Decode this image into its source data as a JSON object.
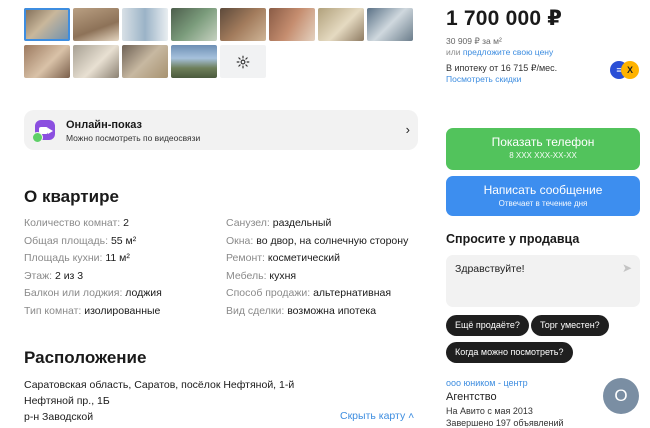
{
  "gallery": {
    "more_icon": "gear-icon"
  },
  "online_view": {
    "title": "Онлайн-показ",
    "subtitle": "Можно посмотреть по видеосвязи",
    "chevron": "›"
  },
  "about": {
    "heading": "О квартире",
    "left": [
      {
        "key": "Количество комнат: ",
        "value": "2"
      },
      {
        "key": "Общая площадь: ",
        "value": "55 м²"
      },
      {
        "key": "Площадь кухни: ",
        "value": "11 м²"
      },
      {
        "key": "Этаж: ",
        "value": "2 из 3"
      },
      {
        "key": "Балкон или лоджия: ",
        "value": "лоджия"
      },
      {
        "key": "Тип комнат: ",
        "value": "изолированные"
      }
    ],
    "right": [
      {
        "key": "Санузел: ",
        "value": "раздельный"
      },
      {
        "key": "Окна: ",
        "value": "во двор, на солнечную сторону"
      },
      {
        "key": "Ремонт: ",
        "value": "косметический"
      },
      {
        "key": "Мебель: ",
        "value": "кухня"
      },
      {
        "key": "Способ продажи: ",
        "value": "альтернативная"
      },
      {
        "key": "Вид сделки: ",
        "value": "возможна ипотека"
      }
    ]
  },
  "location": {
    "heading": "Расположение",
    "address_line1": "Саратовская область, Саратов, посёлок Нефтяной, 1-й",
    "address_line2": "Нефтяной пр., 1Б",
    "district": "р-н Заводской",
    "hide_map": "Скрыть карту ˄"
  },
  "price": {
    "value": "1 700 000 ₽",
    "per_meter": "30 909 ₽ за м²",
    "offer_prefix": "или ",
    "offer_link": "предложите свою цену",
    "mortgage": "В ипотеку от 16 715 ₽/мес.",
    "discounts": "Посмотреть скидки",
    "bank_logo_left": "≡",
    "bank_logo_right": "X"
  },
  "buttons": {
    "phone_label": "Показать телефон",
    "phone_sub": "8 XXX XXX-XX-XX",
    "message_label": "Написать сообщение",
    "message_sub": "Отвечает в течение дня"
  },
  "ask": {
    "heading": "Спросите у продавца",
    "input_value": "Здравствуйте!",
    "send_icon": "➤",
    "chips": [
      "Ещё продаёте?",
      "Торг уместен?",
      "Когда можно посмотреть?"
    ]
  },
  "seller": {
    "name": "ооо юником - центр",
    "type": "Агентство",
    "since": "На Авито с мая 2013",
    "completed": "Завершено 197 объявлений",
    "avatar_letter": "О"
  },
  "colors": {
    "accent_blue": "#3d8de0",
    "phone_green": "#52c35c",
    "message_blue": "#3d8eef"
  }
}
